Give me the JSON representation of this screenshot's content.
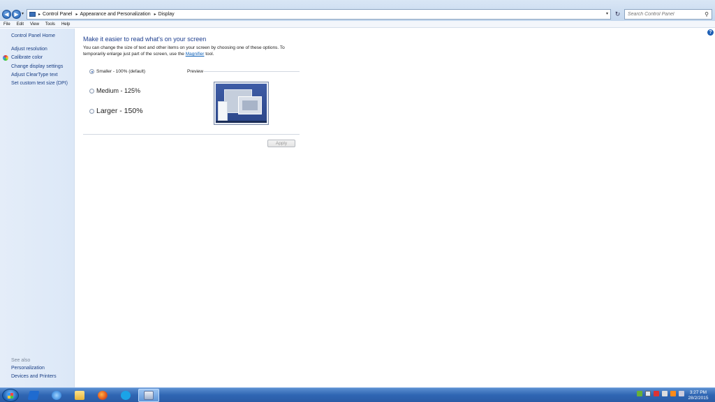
{
  "window": {
    "breadcrumbs": [
      "Control Panel",
      "Appearance and Personalization",
      "Display"
    ],
    "search_placeholder": "Search Control Panel"
  },
  "menu": [
    "File",
    "Edit",
    "View",
    "Tools",
    "Help"
  ],
  "sidebar": {
    "home": "Control Panel Home",
    "links": [
      "Adjust resolution",
      "Calibrate color",
      "Change display settings",
      "Adjust ClearType text",
      "Set custom text size (DPI)"
    ],
    "see_also_heading": "See also",
    "see_also": [
      "Personalization",
      "Devices and Printers"
    ]
  },
  "main": {
    "title": "Make it easier to read what's on your screen",
    "description_pre": "You can change the size of text and other items on your screen by choosing one of these options. To temporarily enlarge just part of the screen, use the",
    "description_link": "Magnifier",
    "description_post": "tool.",
    "options": [
      "Smaller - 100% (default)",
      "Medium - 125%",
      "Larger - 150%"
    ],
    "selected_option": 0,
    "preview_label": "Preview",
    "apply_label": "Apply"
  },
  "taskbar": {
    "time": "3:27 PM",
    "date": "28/2/2015"
  },
  "colors": {
    "link": "#1a3f85",
    "title": "#1e3f8f",
    "sidebar_bg": "#e4edf9",
    "taskbar": "#2f66b3"
  }
}
